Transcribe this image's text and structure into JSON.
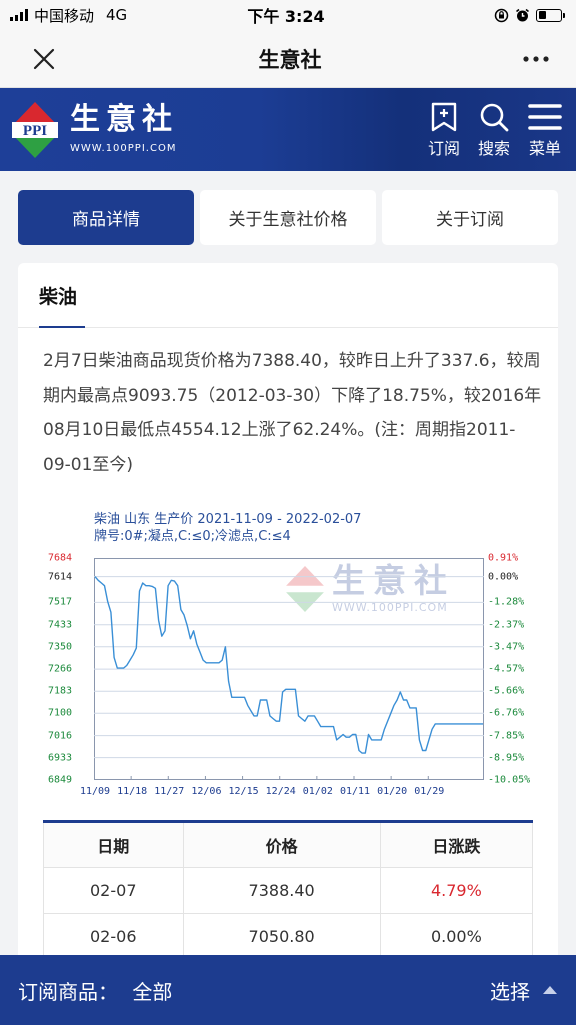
{
  "status_bar": {
    "carrier": "中国移动",
    "network": "4G",
    "time": "下午 3:24"
  },
  "titlebar": {
    "title": "生意社",
    "close_icon": "close-icon",
    "more_icon": "more-icon"
  },
  "brand": {
    "name": "生意社",
    "url": "WWW.100PPI.COM",
    "logo_letters": "PPI",
    "nav": [
      {
        "label": "订阅",
        "icon": "bookmark-plus-icon"
      },
      {
        "label": "搜索",
        "icon": "search-icon"
      },
      {
        "label": "菜单",
        "icon": "menu-icon"
      }
    ],
    "colors": {
      "bar": "#1d3c8f",
      "logo_red": "#d9282f",
      "logo_green": "#2ea043"
    }
  },
  "tabs": [
    {
      "label": "商品详情",
      "active": true
    },
    {
      "label": "关于生意社价格",
      "active": false
    },
    {
      "label": "关于订阅",
      "active": false
    }
  ],
  "product": {
    "name": "柴油",
    "description": "2月7日柴油商品现货价格为7388.40，较昨日上升了337.6，较周期内最高点9093.75（2012-03-30）下降了18.75%，较2016年08月10日最低点4554.12上涨了62.24%。(注：周期指2011-09-01至今)"
  },
  "chart_data": {
    "type": "line",
    "title": "柴油 山东 生产价 2021-11-09 - 2022-02-07",
    "subtitle": "牌号:0#;凝点,C:≤0;冷滤点,C:≤4",
    "watermark": "生意社",
    "watermark_url": "WWW.100PPI.COM",
    "y_ticks": [
      "7684",
      "7614",
      "7517",
      "7433",
      "7350",
      "7266",
      "7183",
      "7100",
      "7016",
      "6933",
      "6849"
    ],
    "pct_ticks": [
      "0.91%",
      "0.00%",
      "-1.28%",
      "-2.37%",
      "-3.47%",
      "-4.57%",
      "-5.66%",
      "-6.76%",
      "-7.85%",
      "-8.95%",
      "-10.05%"
    ],
    "x_ticks": [
      "11/09",
      "11/18",
      "11/27",
      "12/06",
      "12/15",
      "12/24",
      "01/02",
      "01/11",
      "01/20",
      "01/29"
    ],
    "ylim": [
      6849,
      7684
    ],
    "colors": {
      "line": "#3a8fd6",
      "grid": "#cfd8e6",
      "top_tick": "#d9282f",
      "tick": "#1c8a3c",
      "x_tick": "#1d3c8f"
    },
    "values": [
      7614,
      7600,
      7590,
      7580,
      7520,
      7480,
      7310,
      7270,
      7270,
      7270,
      7280,
      7300,
      7320,
      7345,
      7560,
      7590,
      7580,
      7580,
      7577,
      7570,
      7450,
      7390,
      7410,
      7580,
      7600,
      7597,
      7580,
      7490,
      7470,
      7430,
      7380,
      7410,
      7360,
      7330,
      7300,
      7290,
      7290,
      7290,
      7290,
      7290,
      7300,
      7350,
      7220,
      7160,
      7160,
      7160,
      7160,
      7160,
      7130,
      7110,
      7090,
      7090,
      7150,
      7150,
      7150,
      7090,
      7080,
      7070,
      7070,
      7180,
      7190,
      7190,
      7190,
      7190,
      7090,
      7080,
      7070,
      7090,
      7090,
      7090,
      7070,
      7050,
      7050,
      7050,
      7050,
      7050,
      7000,
      7010,
      7020,
      7010,
      7010,
      7020,
      7020,
      6960,
      6950,
      6950,
      7020,
      7000,
      7000,
      7000,
      7000,
      7040,
      7070,
      7100,
      7130,
      7150,
      7180,
      7150,
      7150,
      7120,
      7120,
      7120,
      7000,
      6960,
      6960,
      7000,
      7040,
      7060,
      7060,
      7060,
      7060,
      7060,
      7060,
      7060,
      7060,
      7060,
      7060,
      7060,
      7060,
      7060,
      7060,
      7060,
      7060
    ]
  },
  "table": {
    "headers": [
      "日期",
      "价格",
      "日涨跌"
    ],
    "rows": [
      {
        "date": "02-07",
        "price": "7388.40",
        "change": "4.79%"
      },
      {
        "date": "02-06",
        "price": "7050.80",
        "change": "0.00%"
      }
    ]
  },
  "bottom_bar": {
    "label": "订阅商品：",
    "value": "全部",
    "select_label": "选择"
  }
}
